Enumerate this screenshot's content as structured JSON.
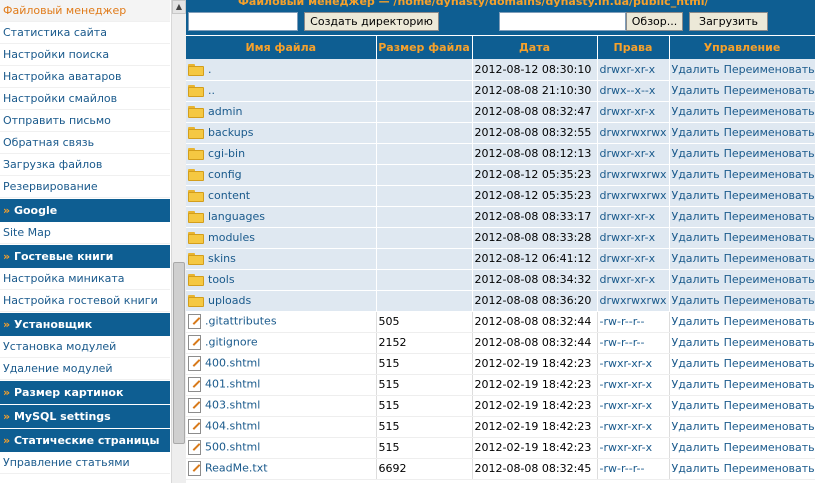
{
  "sidebar": {
    "items": [
      {
        "type": "link",
        "label": "Файловый менеджер",
        "active": true
      },
      {
        "type": "link",
        "label": "Статистика сайта"
      },
      {
        "type": "link",
        "label": "Настройки поиска"
      },
      {
        "type": "link",
        "label": "Настройка аватаров"
      },
      {
        "type": "link",
        "label": "Настройки смайлов"
      },
      {
        "type": "link",
        "label": "Отправить письмо"
      },
      {
        "type": "link",
        "label": "Обратная связь"
      },
      {
        "type": "link",
        "label": "Загрузка файлов"
      },
      {
        "type": "link",
        "label": "Резервирование"
      },
      {
        "type": "header",
        "label": "Google"
      },
      {
        "type": "link",
        "label": "Site Map"
      },
      {
        "type": "header",
        "label": "Гостевые книги"
      },
      {
        "type": "link",
        "label": "Настройка миниката"
      },
      {
        "type": "link",
        "label": "Настройка гостевой книги"
      },
      {
        "type": "header",
        "label": "Установщик"
      },
      {
        "type": "link",
        "label": "Установка модулей"
      },
      {
        "type": "link",
        "label": "Удаление модулей"
      },
      {
        "type": "header",
        "label": "Размер картинок"
      },
      {
        "type": "header",
        "label": "MySQL settings"
      },
      {
        "type": "header",
        "label": "Статические страницы"
      },
      {
        "type": "link",
        "label": "Управление статьями"
      }
    ],
    "header_arrow": "»"
  },
  "path_title": "Файловый менеджер — /home/dynasty/domains/dynasty.in.ua/public_html/",
  "toolbar": {
    "dir_input_value": "",
    "create_dir_label": "Создать директорию",
    "file_input_value": "",
    "browse_label": "Обзор...",
    "upload_label": "Загрузить"
  },
  "table": {
    "columns": [
      "Имя файла",
      "Размер файла",
      "Дата",
      "Права",
      "Управление"
    ],
    "delete_label": "Удалить",
    "rename_label": "Переименовать",
    "rows": [
      {
        "kind": "dir",
        "name": ".",
        "size": "",
        "date": "2012-08-12 08:30:10",
        "perm": "drwxr-xr-x"
      },
      {
        "kind": "dir",
        "name": "..",
        "size": "",
        "date": "2012-08-08 21:10:30",
        "perm": "drwx--x--x"
      },
      {
        "kind": "dir",
        "name": "admin",
        "size": "",
        "date": "2012-08-08 08:32:47",
        "perm": "drwxr-xr-x"
      },
      {
        "kind": "dir",
        "name": "backups",
        "size": "",
        "date": "2012-08-08 08:32:55",
        "perm": "drwxrwxrwx"
      },
      {
        "kind": "dir",
        "name": "cgi-bin",
        "size": "",
        "date": "2012-08-08 08:12:13",
        "perm": "drwxr-xr-x"
      },
      {
        "kind": "dir",
        "name": "config",
        "size": "",
        "date": "2012-08-12 05:35:23",
        "perm": "drwxrwxrwx"
      },
      {
        "kind": "dir",
        "name": "content",
        "size": "",
        "date": "2012-08-12 05:35:23",
        "perm": "drwxrwxrwx"
      },
      {
        "kind": "dir",
        "name": "languages",
        "size": "",
        "date": "2012-08-08 08:33:17",
        "perm": "drwxr-xr-x"
      },
      {
        "kind": "dir",
        "name": "modules",
        "size": "",
        "date": "2012-08-08 08:33:28",
        "perm": "drwxr-xr-x"
      },
      {
        "kind": "dir",
        "name": "skins",
        "size": "",
        "date": "2012-08-12 06:41:12",
        "perm": "drwxr-xr-x"
      },
      {
        "kind": "dir",
        "name": "tools",
        "size": "",
        "date": "2012-08-08 08:34:32",
        "perm": "drwxr-xr-x"
      },
      {
        "kind": "dir",
        "name": "uploads",
        "size": "",
        "date": "2012-08-08 08:36:20",
        "perm": "drwxrwxrwx"
      },
      {
        "kind": "file",
        "name": ".gitattributes",
        "size": "505",
        "date": "2012-08-08 08:32:44",
        "perm": "-rw-r--r--"
      },
      {
        "kind": "file",
        "name": ".gitignore",
        "size": "2152",
        "date": "2012-08-08 08:32:44",
        "perm": "-rw-r--r--"
      },
      {
        "kind": "file",
        "name": "400.shtml",
        "size": "515",
        "date": "2012-02-19 18:42:23",
        "perm": "-rwxr-xr-x"
      },
      {
        "kind": "file",
        "name": "401.shtml",
        "size": "515",
        "date": "2012-02-19 18:42:23",
        "perm": "-rwxr-xr-x"
      },
      {
        "kind": "file",
        "name": "403.shtml",
        "size": "515",
        "date": "2012-02-19 18:42:23",
        "perm": "-rwxr-xr-x"
      },
      {
        "kind": "file",
        "name": "404.shtml",
        "size": "515",
        "date": "2012-02-19 18:42:23",
        "perm": "-rwxr-xr-x"
      },
      {
        "kind": "file",
        "name": "500.shtml",
        "size": "515",
        "date": "2012-02-19 18:42:23",
        "perm": "-rwxr-xr-x"
      },
      {
        "kind": "file",
        "name": "ReadMe.txt",
        "size": "6692",
        "date": "2012-08-08 08:32:45",
        "perm": "-rw-r--r--"
      }
    ]
  },
  "colors": {
    "header_bg": "#0e5e92",
    "header_text": "#f6a12b",
    "link": "#1a5a8c",
    "dir_row_bg": "#dfe8f1"
  },
  "icons": {
    "folder": "folder-icon",
    "file": "file-icon"
  }
}
